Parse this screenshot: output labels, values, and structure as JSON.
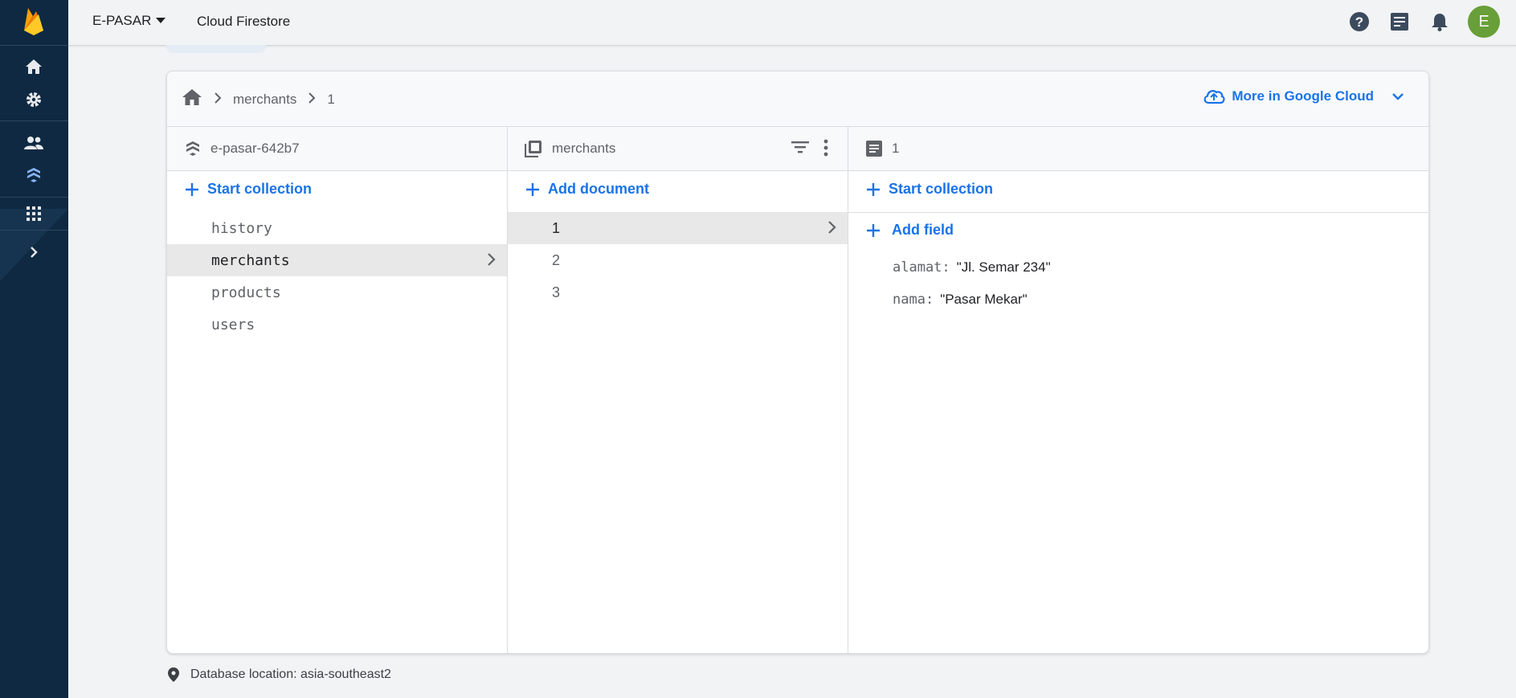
{
  "topbar": {
    "project": "E-PASAR",
    "product": "Cloud Firestore",
    "avatar_letter": "E"
  },
  "breadcrumb": {
    "collection": "merchants",
    "document": "1",
    "cloud_button": "More in Google Cloud"
  },
  "columns": {
    "root": {
      "title": "e-pasar-642b7",
      "action": "Start collection",
      "items": [
        "history",
        "merchants",
        "products",
        "users"
      ],
      "selected": "merchants"
    },
    "collection": {
      "title": "merchants",
      "action": "Add document",
      "items": [
        "1",
        "2",
        "3"
      ],
      "selected": "1"
    },
    "document": {
      "title": "1",
      "action": "Start collection",
      "add_field": "Add field",
      "fields": [
        {
          "key": "alamat:",
          "value": "\"Jl. Semar 234\""
        },
        {
          "key": "nama:",
          "value": "\"Pasar Mekar\""
        }
      ]
    }
  },
  "footer": {
    "location": "Database location: asia-southeast2"
  },
  "colors": {
    "accent": "#1a73e8",
    "rail": "#0f2942",
    "avatar": "#689f38"
  }
}
